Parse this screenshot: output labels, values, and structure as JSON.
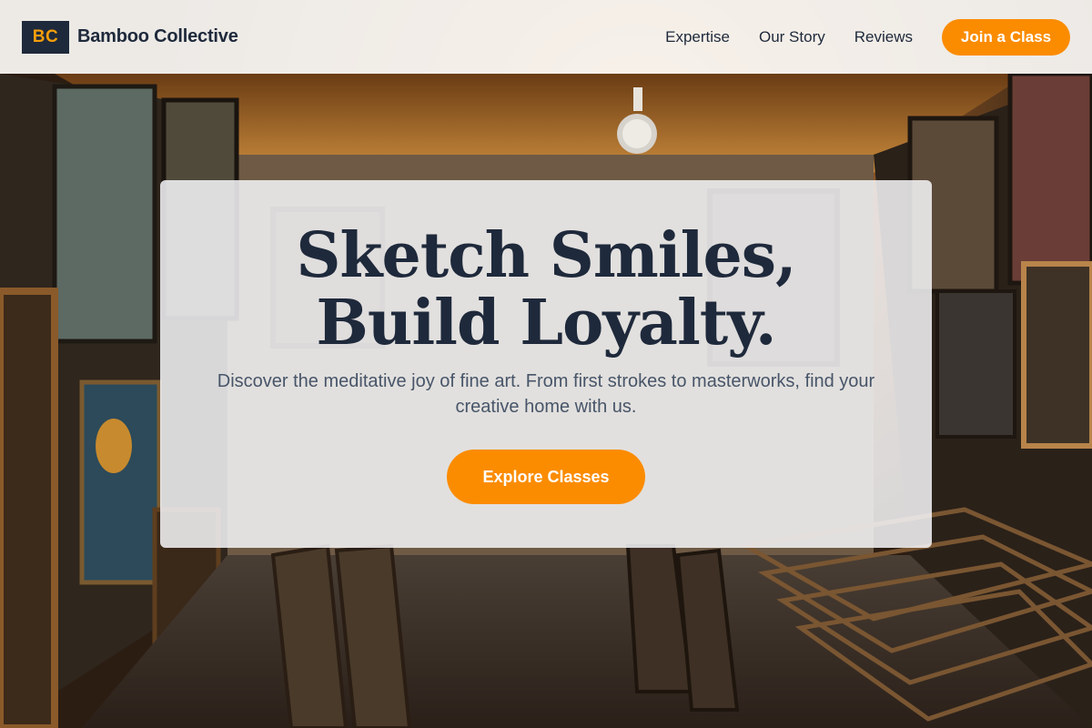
{
  "header": {
    "logo_text": "BC",
    "brand_name": "Bamboo Collective",
    "nav": [
      {
        "label": "Expertise"
      },
      {
        "label": "Our Story"
      },
      {
        "label": "Reviews"
      }
    ],
    "cta_label": "Join a Class"
  },
  "hero": {
    "title": "Sketch Smiles, Build Loyalty.",
    "subtitle": "Discover the meditative joy of fine art. From first strokes to masterworks, find your creative home with us.",
    "cta_label": "Explore Classes"
  },
  "colors": {
    "accent": "#fb8c00",
    "navy": "#1e293b",
    "logo_text": "#f59e0b",
    "subtitle": "#475569"
  }
}
